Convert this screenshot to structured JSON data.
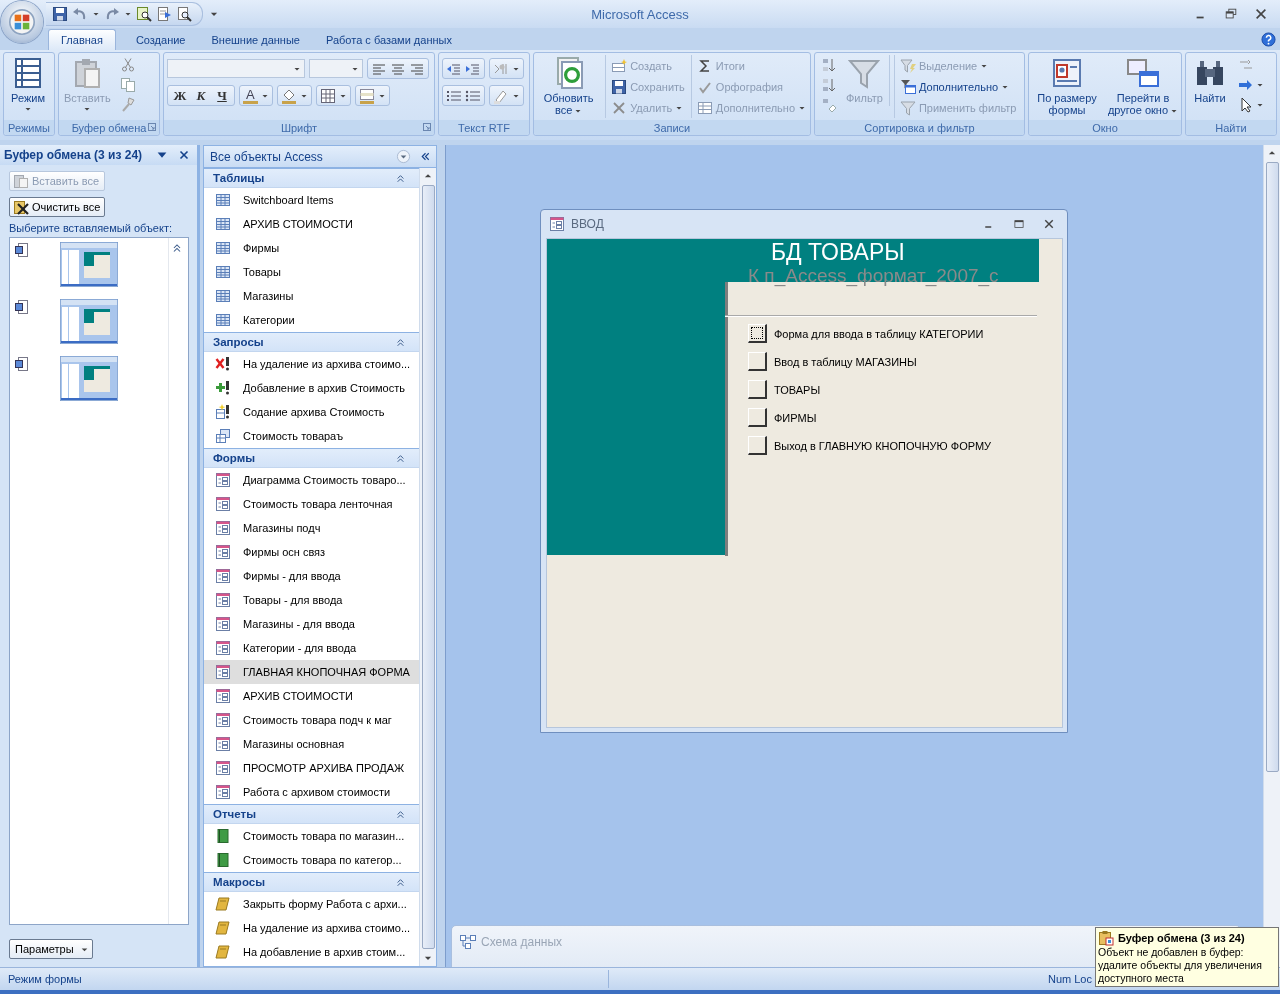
{
  "title_bar": {
    "title": "Microsoft Access"
  },
  "ribbon": {
    "tabs": [
      {
        "label": "Главная",
        "selected": true
      },
      {
        "label": "Создание",
        "selected": false
      },
      {
        "label": "Внешние данные",
        "selected": false
      },
      {
        "label": "Работа с базами данных",
        "selected": false
      }
    ],
    "groups": [
      {
        "kind": "views",
        "label": "Режимы",
        "launcher": false,
        "buttons": [
          {
            "kind": "large",
            "label": "Режим",
            "dropdown": true,
            "disabled": false
          }
        ]
      },
      {
        "kind": "clipboard",
        "label": "Буфер обмена",
        "launcher": true,
        "buttons": [
          {
            "kind": "large",
            "label": "Вставить",
            "dropdown": true,
            "disabled": true
          }
        ]
      },
      {
        "kind": "font",
        "label": "Шрифт",
        "launcher": true,
        "format_keys": [
          "Ж",
          "К",
          "Ч"
        ],
        "font_color_key": "A"
      },
      {
        "kind": "rtf",
        "label": "Текст RTF",
        "launcher": false
      },
      {
        "kind": "records",
        "label": "Записи",
        "launcher": false,
        "buttons": [
          {
            "kind": "large",
            "label": "Обновить все",
            "dropdown": true,
            "disabled": false
          },
          {
            "kind": "small",
            "label": "Создать",
            "dropdown": false,
            "disabled": true
          },
          {
            "kind": "small",
            "label": "Сохранить",
            "dropdown": false,
            "disabled": true
          },
          {
            "kind": "small",
            "label": "Удалить",
            "dropdown": true,
            "disabled": true
          },
          {
            "kind": "small",
            "label": "Итоги",
            "dropdown": false,
            "disabled": true
          },
          {
            "kind": "small",
            "label": "Орфография",
            "dropdown": false,
            "disabled": true
          },
          {
            "kind": "small",
            "label": "Дополнительно",
            "dropdown": true,
            "disabled": true
          }
        ]
      },
      {
        "kind": "sort",
        "label": "Сортировка и фильтр",
        "launcher": false,
        "buttons": [
          {
            "kind": "large",
            "label": "Фильтр",
            "dropdown": false,
            "disabled": true
          },
          {
            "kind": "small",
            "label": "Выделение",
            "dropdown": true,
            "disabled": true
          },
          {
            "kind": "small",
            "label": "Дополнительно",
            "dropdown": true,
            "disabled": false
          },
          {
            "kind": "small",
            "label": "Применить фильтр",
            "dropdown": false,
            "disabled": true
          }
        ]
      },
      {
        "kind": "window",
        "label": "Окно",
        "launcher": false,
        "buttons": [
          {
            "kind": "large",
            "label": "По размеру формы",
            "dropdown": false,
            "disabled": false
          },
          {
            "kind": "large",
            "label": "Перейти в другое окно",
            "dropdown": true,
            "disabled": false
          }
        ]
      },
      {
        "kind": "find",
        "label": "Найти",
        "launcher": false,
        "buttons": [
          {
            "kind": "large",
            "label": "Найти",
            "dropdown": false,
            "disabled": false
          }
        ]
      }
    ]
  },
  "clipboard_pane": {
    "title": "Буфер обмена (3 из 24)",
    "paste_all": {
      "label": "Вставить все",
      "disabled": true
    },
    "clear_all": {
      "label": "Очистить все",
      "disabled": false
    },
    "prompt": "Выберите вставляемый объект:",
    "options_button": "Параметры"
  },
  "nav_pane": {
    "title": "Все объекты Access",
    "groups": [
      {
        "kind": "tables",
        "title": "Таблицы",
        "expanded": true,
        "items": [
          {
            "label": "Switchboard Items",
            "selected": false
          },
          {
            "label": "АРХИВ СТОИМОСТИ",
            "selected": false
          },
          {
            "label": "Фирмы",
            "selected": false
          },
          {
            "label": "Товары",
            "selected": false
          },
          {
            "label": "Магазины",
            "selected": false
          },
          {
            "label": "Категории",
            "selected": false
          }
        ]
      },
      {
        "kind": "queries",
        "title": "Запросы",
        "expanded": true,
        "items": [
          {
            "label": "На удаление из архива стоимо...",
            "kind": "delete",
            "selected": false
          },
          {
            "label": "Добавление в архив Стоимость",
            "kind": "append",
            "selected": false
          },
          {
            "label": "Содание архива Стоимость",
            "kind": "make-table",
            "selected": false
          },
          {
            "label": "Стоимость товараъ",
            "kind": "select",
            "selected": false
          }
        ]
      },
      {
        "kind": "forms",
        "title": "Формы",
        "expanded": true,
        "items": [
          {
            "label": "Диаграмма Стоимость товаро...",
            "selected": false
          },
          {
            "label": "Стоимость товара ленточная",
            "selected": false
          },
          {
            "label": "Магазины подч",
            "selected": false
          },
          {
            "label": "Фирмы осн связ",
            "selected": false
          },
          {
            "label": "Фирмы - для ввода",
            "selected": false
          },
          {
            "label": "Товары - для ввода",
            "selected": false
          },
          {
            "label": "Магазины - для ввода",
            "selected": false
          },
          {
            "label": "Категории - для ввода",
            "selected": false
          },
          {
            "label": "ГЛАВНАЯ КНОПОЧНАЯ ФОРМА",
            "selected": true
          },
          {
            "label": "АРХИВ СТОИМОСТИ",
            "selected": false
          },
          {
            "label": "Стоимость товара подч к маг",
            "selected": false
          },
          {
            "label": "Магазины основная",
            "selected": false
          },
          {
            "label": "ПРОСМОТР АРХИВА ПРОДАЖ",
            "selected": false
          },
          {
            "label": "Работа с архивом стоимости",
            "selected": false
          }
        ]
      },
      {
        "kind": "reports",
        "title": "Отчеты",
        "expanded": true,
        "items": [
          {
            "label": "Стоимость товара по магазин...",
            "selected": false
          },
          {
            "label": "Стоимость товара по категор...",
            "selected": false
          }
        ]
      },
      {
        "kind": "macros",
        "title": "Макросы",
        "expanded": true,
        "items": [
          {
            "label": "Закрыть форму Работа с архи...",
            "selected": false
          },
          {
            "label": "На удаление из архива стоимо...",
            "selected": false
          },
          {
            "label": "На добавление в архив стоим...",
            "selected": false
          }
        ]
      }
    ]
  },
  "form_window": {
    "title": "ВВОД",
    "heading": "БД ТОВАРЫ",
    "subheading": "К п_Access_формат_2007_с",
    "buttons": [
      {
        "label": "Форма для ввода в таблицу КАТЕГОРИИ",
        "focused": true
      },
      {
        "label": "Ввод в таблицу МАГАЗИНЫ",
        "focused": false
      },
      {
        "label": "ТОВАРЫ",
        "focused": false
      },
      {
        "label": "ФИРМЫ",
        "focused": false
      },
      {
        "label": "Выход в ГЛАВНУЮ КНОПОЧНУЮ ФОРМУ",
        "focused": false
      }
    ]
  },
  "minimized_window": {
    "title": "Схема данных"
  },
  "tooltip": {
    "title": "Буфер обмена (3 из 24)",
    "text": "Объект не добавлен в буфер: удалите объекты для увеличения доступного места"
  },
  "status_bar": {
    "mode": "Режим формы",
    "indicator": "Num Loc"
  }
}
